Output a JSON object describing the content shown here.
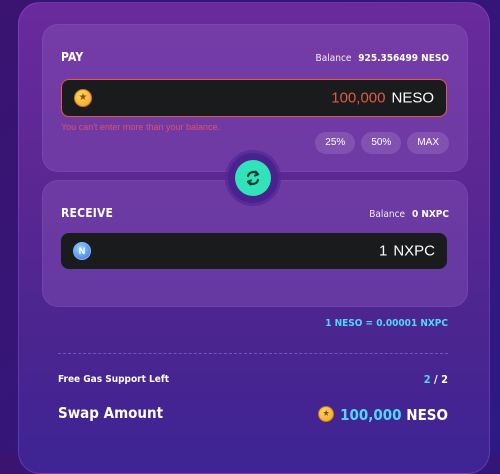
{
  "pay": {
    "label": "PAY",
    "balance_label": "Balance",
    "balance_value": "925.356499 NESO",
    "amount": "100,000",
    "token": "NESO",
    "token_icon": "neso-coin-icon",
    "error": "You can't enter more than your balance.",
    "percent_buttons": [
      "25%",
      "50%",
      "MAX"
    ]
  },
  "receive": {
    "label": "RECEIVE",
    "balance_label": "Balance",
    "balance_value": "0 NXPC",
    "amount": "1",
    "token": "NXPC",
    "token_icon": "nxpc-coin-icon"
  },
  "rate": "1 NESO = 0.00001 NXPC",
  "gas": {
    "label": "Free Gas Support Left",
    "current": "2",
    "total": "2"
  },
  "swap": {
    "label": "Swap Amount",
    "amount": "100,000",
    "token": "NESO"
  },
  "colors": {
    "accent_cyan": "#4fd8ff",
    "swap_button": "#32e2b8",
    "error": "#e05a46"
  }
}
